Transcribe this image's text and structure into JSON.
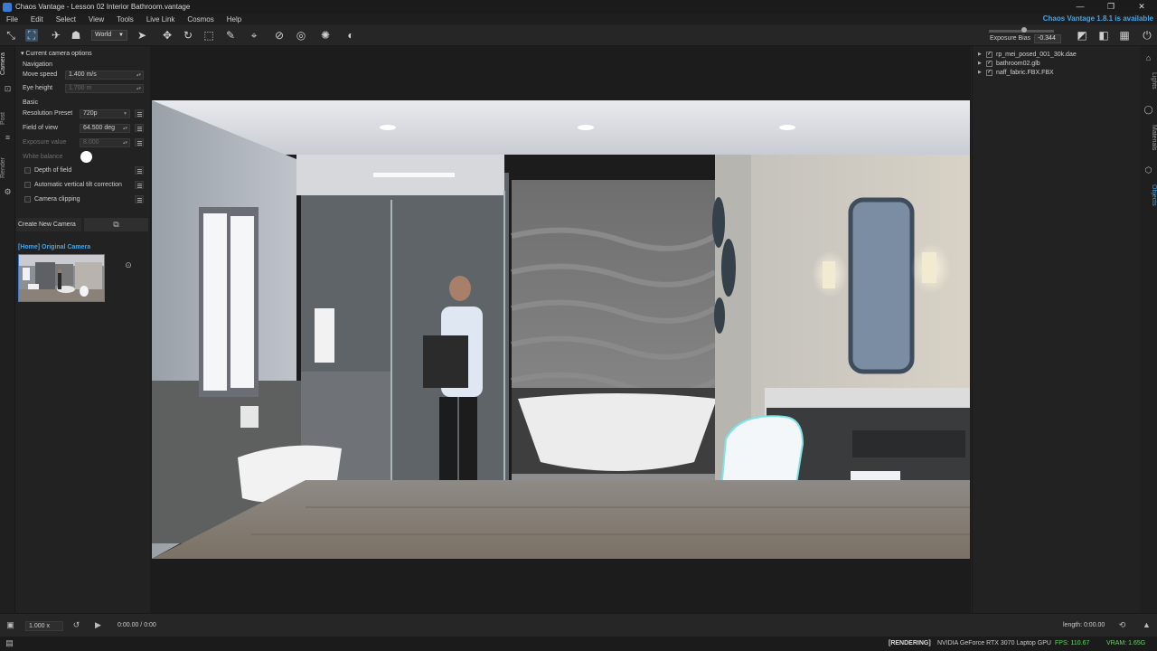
{
  "window": {
    "title": "Chaos Vantage - Lesson 02 Interior Bathroom.vantage",
    "controls": [
      "—",
      "❐",
      "✕"
    ]
  },
  "menu": {
    "items": [
      "File",
      "Edit",
      "Select",
      "View",
      "Tools",
      "Live Link",
      "Cosmos",
      "Help"
    ],
    "update_notice": "Chaos Vantage 1.8.1 is available"
  },
  "toolbar": {
    "space_select": "World",
    "exposure_label": "Exposure Bias",
    "exposure_value": "-0.344",
    "exposure_level": 0.5
  },
  "left_rail": {
    "tabs": [
      "Camera",
      "Post",
      "Render"
    ]
  },
  "camera_panel": {
    "section_title": "Current camera options",
    "navigation_label": "Navigation",
    "move_speed_label": "Move speed",
    "move_speed_value": "1.400 m/s",
    "eye_height_label": "Eye height",
    "eye_height_value": "1.700 m",
    "basic_label": "Basic",
    "resolution_label": "Resolution Preset",
    "resolution_value": "720p",
    "fov_label": "Field of view",
    "fov_value": "64.500 deg",
    "exposure_label": "Exposure value",
    "exposure_value": "8.000",
    "white_balance_label": "White balance",
    "dof_label": "Depth of field",
    "tilt_label": "Automatic vertical tilt correction",
    "clipping_label": "Camera clipping",
    "create_camera_label": "Create New Camera",
    "camera_name": "[Home] Original Camera"
  },
  "outliner": {
    "items": [
      {
        "name": "rp_mei_posed_001_30k.dae",
        "checked": true
      },
      {
        "name": "bathroom02.glb",
        "checked": true
      },
      {
        "name": "naff_fabric.FBX.FBX",
        "checked": true
      }
    ]
  },
  "right_rail": {
    "tabs": [
      "Lights",
      "Materials",
      "Objects"
    ]
  },
  "timeline": {
    "speed": "1.000 x",
    "time": "0:00.00 / 0:00",
    "length": "length: 0:00.00"
  },
  "status": {
    "state": "[RENDERING]",
    "gpu": "NVIDIA GeForce RTX 3070 Laptop GPU",
    "fps": "FPS: 110.67",
    "vram": "VRAM: 1.65G"
  },
  "colors": {
    "accent": "#4aa3e0",
    "ok": "#6fd06f"
  }
}
